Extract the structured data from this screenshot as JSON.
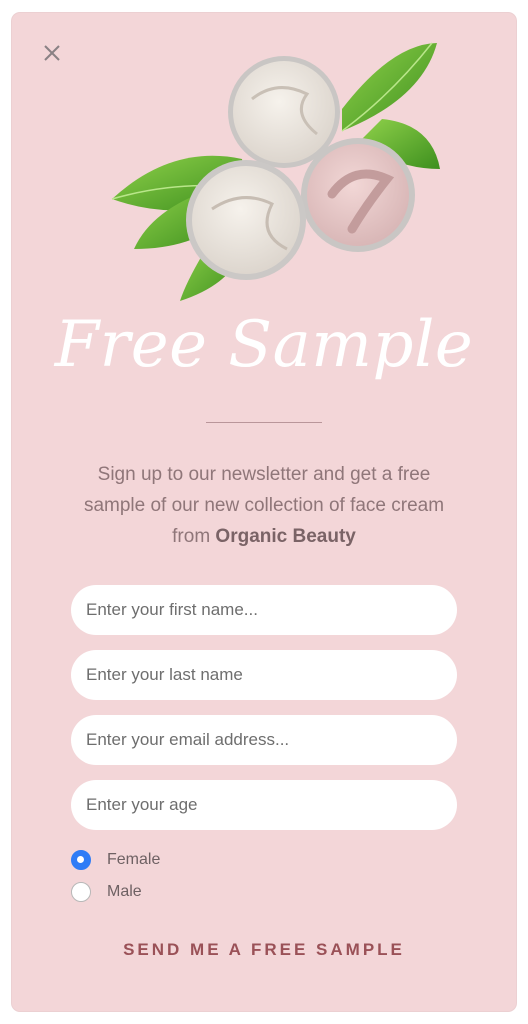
{
  "popup": {
    "title": "Free Sample",
    "description_text": "Sign up to our newsletter and get a free sample of our new collection of face cream from ",
    "brand_name": "Organic Beauty",
    "close_icon": "close-icon",
    "image": "face-cream-jars-with-leaves"
  },
  "form": {
    "first_name_placeholder": "Enter your first name...",
    "last_name_placeholder": "Enter your last name",
    "email_placeholder": "Enter your email address...",
    "age_placeholder": "Enter your age",
    "gender_options": [
      {
        "label": "Female",
        "selected": true
      },
      {
        "label": "Male",
        "selected": false
      }
    ],
    "submit_label": "SEND ME A FREE SAMPLE"
  },
  "colors": {
    "background": "#f3d6d8",
    "accent": "#9a5157",
    "radio_selected": "#2f7cf6"
  }
}
